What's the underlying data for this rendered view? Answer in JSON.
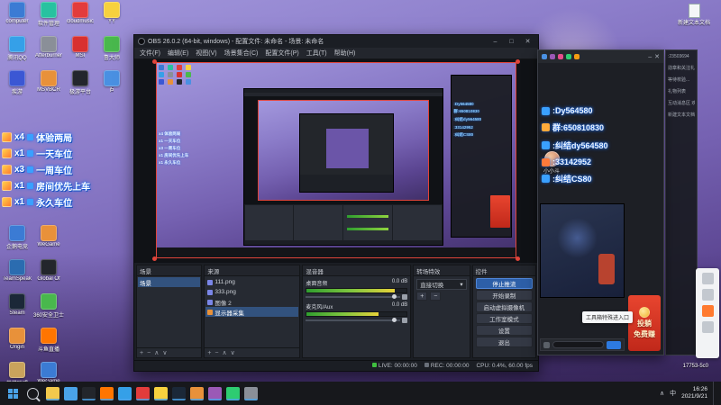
{
  "colors": {
    "accent_blue": "#2d5fa8",
    "chat_glow_blue": "#1b6ef3",
    "live_green": "#3fbf3f",
    "banner_red": "#e8452f",
    "taskbar_accent": "#4aa3e8"
  },
  "icons": {
    "close": "✕",
    "minimize": "–",
    "maximize": "□",
    "chevron_down": "▾",
    "plus": "+",
    "minus": "−",
    "caret_up": "∧",
    "caret_down": "∨",
    "eye": "◉",
    "lock": "●"
  },
  "desktop": {
    "top_icons": [
      {
        "label": "computer",
        "color": "#3b7bd4"
      },
      {
        "label": "软件管理",
        "color": "#27c2a0"
      },
      {
        "label": "cloudmusic",
        "color": "#e23c3c"
      },
      {
        "label": "YY",
        "color": "#f7d13e"
      },
      {
        "label": "腾讯QQ",
        "color": "#35a0e8"
      },
      {
        "label": "Afterburner",
        "color": "#8a8f98"
      },
      {
        "label": "MSI",
        "color": "#d8302f"
      },
      {
        "label": "鲁大师",
        "color": "#49b84d"
      },
      {
        "label": "疾游",
        "color": "#3b57d4"
      },
      {
        "label": "MSVBCR",
        "color": "#e8913a"
      },
      {
        "label": "极游平台",
        "color": "#23262c"
      },
      {
        "label": "j5",
        "color": "#4a90e2"
      }
    ],
    "left_icons": [
      {
        "label": "企鹅电竞",
        "color": "#3b7bd4"
      },
      {
        "label": "WeGame",
        "color": "#e8913a"
      },
      {
        "label": "TeamSpeak",
        "color": "#2b6cb0"
      },
      {
        "label": "Global Of",
        "color": "#23262c"
      },
      {
        "label": "Steam",
        "color": "#1b2838"
      },
      {
        "label": "360安全卫士",
        "color": "#49b84d"
      },
      {
        "label": "Origin",
        "color": "#e8913a"
      },
      {
        "label": "斗鱼直播",
        "color": "#ff7500"
      },
      {
        "label": "英雄联盟",
        "color": "#c9a35c"
      },
      {
        "label": "WeGame",
        "color": "#3b7bd4"
      }
    ],
    "badges": [
      {
        "count": "x4",
        "label": "体验两局"
      },
      {
        "count": "x1",
        "label": "一天车位"
      },
      {
        "count": "x3",
        "label": "一周车位"
      },
      {
        "count": "x1",
        "label": "房间优先上车"
      },
      {
        "count": "x1",
        "label": "永久车位"
      }
    ],
    "right_icon_label": "新建文本文档",
    "bottom_right_label": "17753-5c0"
  },
  "obs": {
    "title": "OBS 26.0.2 (64-bit, windows) - 配置文件: 未命名 - 场景: 未命名",
    "menus": [
      "文件(F)",
      "编辑(E)",
      "视图(V)",
      "场景集合(C)",
      "配置文件(P)",
      "工具(T)",
      "帮助(H)"
    ],
    "scenes": {
      "title": "场景",
      "items": [
        {
          "name": "场景",
          "selected": true
        }
      ]
    },
    "sources": {
      "title": "来源",
      "items": [
        {
          "name": "111.png",
          "color": "#7a86e8"
        },
        {
          "name": "333.png",
          "color": "#7a86e8"
        },
        {
          "name": "图像 2",
          "color": "#7a86e8"
        },
        {
          "name": "显示器采集",
          "color": "#e8913a",
          "selected": true
        }
      ]
    },
    "mixer": {
      "title": "混音器",
      "channels": [
        {
          "name": "桌面音频",
          "db": "0.0 dB",
          "level": "88%"
        },
        {
          "name": "麦克风/Aux",
          "db": "0.0 dB",
          "level": "72%"
        }
      ]
    },
    "transitions": {
      "title": "转场特效",
      "selected": "直接切换"
    },
    "controls": {
      "title": "控件",
      "buttons": [
        {
          "label": "停止推流",
          "active": true
        },
        {
          "label": "开始录制"
        },
        {
          "label": "启动虚拟摄像机"
        },
        {
          "label": "工作室模式"
        },
        {
          "label": "设置"
        },
        {
          "label": "退出"
        }
      ]
    },
    "status": {
      "live": "LIVE: 00:00:00",
      "rec": "REC: 00:00:00",
      "cpu": "CPU: 0.4%, 60.00 fps"
    }
  },
  "chat": {
    "messages": [
      {
        "text": ":Dy564580",
        "icon": "#3aa0ff"
      },
      {
        "text": "群:650810830",
        "icon": "#ffaa3a"
      },
      {
        "text": ":纠结dy564580",
        "icon": "#3aa0ff"
      },
      {
        "text": ":33142952",
        "icon": "#ff7a3a"
      },
      {
        "text": ":纠结CS80",
        "icon": "#3aa0ff"
      }
    ]
  },
  "companion": {
    "viewer_name": "小小斗",
    "gift_banner_line1": "投躺",
    "gift_banner_line2": "免费赚",
    "tooltip": "工具箱特殊进入口",
    "side_lines": [
      ":23503694",
      "勋章和关注礼物",
      "等待校验...",
      "礼物列表",
      "互动消息区 欢迎来",
      "新建文本文档"
    ]
  },
  "taskbar": {
    "time": "16:26",
    "date": "2021/9/21",
    "ime": "中",
    "apps": [
      {
        "name": "explorer",
        "color": "#f2c94c"
      },
      {
        "name": "browser",
        "color": "#4aa3e8"
      },
      {
        "name": "obs",
        "color": "#23262c"
      },
      {
        "name": "douyu",
        "color": "#ff7500"
      },
      {
        "name": "qq",
        "color": "#35a0e8"
      },
      {
        "name": "music",
        "color": "#e23c3c"
      },
      {
        "name": "yy",
        "color": "#f7d13e"
      },
      {
        "name": "steam",
        "color": "#1b2838"
      },
      {
        "name": "wegame",
        "color": "#e8913a"
      },
      {
        "name": "game",
        "color": "#9b59b6"
      },
      {
        "name": "chat",
        "color": "#2ecc71"
      },
      {
        "name": "tool",
        "color": "#8a8f98"
      }
    ]
  }
}
